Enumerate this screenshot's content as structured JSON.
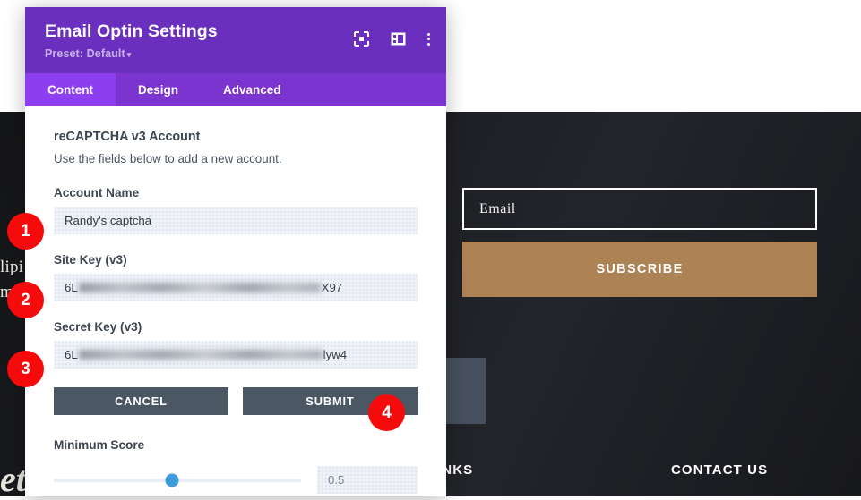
{
  "background": {
    "left_text": [
      "lipi",
      "m",
      "et"
    ],
    "optin": {
      "email_placeholder": "Email",
      "subscribe_label": "SUBSCRIBE"
    },
    "footer": {
      "links_heading": "INKS",
      "contact_heading": "CONTACT US"
    }
  },
  "modal": {
    "title": "Email Optin Settings",
    "preset_label": "Preset: Default",
    "preset_caret": "▾",
    "icons": {
      "focus": "focus-target-icon",
      "layout": "layout-panel-icon",
      "menu": "more-vertical-icon"
    },
    "tabs": [
      {
        "label": "Content",
        "active": true
      },
      {
        "label": "Design",
        "active": false
      },
      {
        "label": "Advanced",
        "active": false
      }
    ],
    "section": {
      "title": "reCAPTCHA v3 Account",
      "subtitle": "Use the fields below to add a new account."
    },
    "fields": {
      "account_name": {
        "label": "Account Name",
        "value": "Randy's captcha"
      },
      "site_key": {
        "label": "Site Key (v3)",
        "prefix": "6L",
        "suffix": "X97",
        "redacted": true
      },
      "secret_key": {
        "label": "Secret Key (v3)",
        "prefix": "6L",
        "suffix": "lyw4",
        "redacted": true
      },
      "minimum_score": {
        "label": "Minimum Score",
        "value": "0.5",
        "percent": 48
      }
    },
    "buttons": {
      "cancel": "CANCEL",
      "submit": "SUBMIT"
    }
  },
  "callouts": [
    {
      "number": "1",
      "target": "account-name-field"
    },
    {
      "number": "2",
      "target": "site-key-field"
    },
    {
      "number": "3",
      "target": "secret-key-field"
    },
    {
      "number": "4",
      "target": "submit-button"
    }
  ],
  "colors": {
    "header_purple": "#6b2fc0",
    "tab_purple": "#7b34cf",
    "tab_active_purple": "#8d3ef0",
    "button_slate": "#4c5764",
    "badge_red": "#f50b0b",
    "subscribe_tan": "#ad8254",
    "slider_blue": "#3e9ad8",
    "field_bg": "#eef2f8"
  }
}
